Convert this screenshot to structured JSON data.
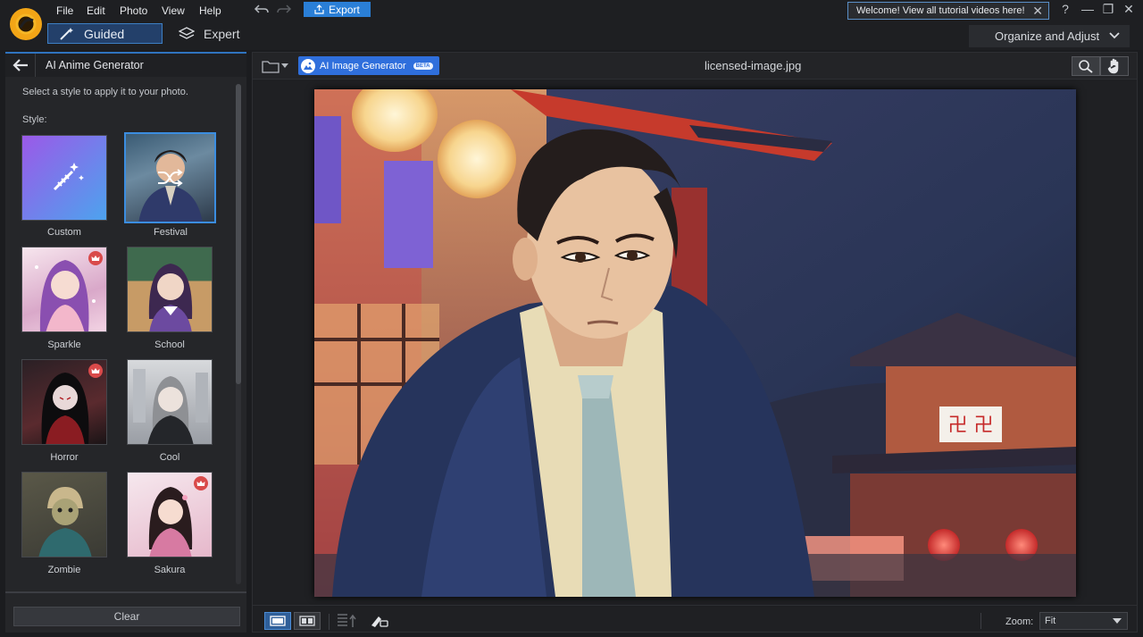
{
  "menu": [
    "File",
    "Edit",
    "Photo",
    "View",
    "Help"
  ],
  "toolbar": {
    "export_label": "Export"
  },
  "welcome": {
    "text": "Welcome! View all tutorial videos here!"
  },
  "modes": {
    "guided": "Guided",
    "expert": "Expert"
  },
  "workspace": {
    "selected": "Organize and Adjust"
  },
  "panel": {
    "title": "AI Anime Generator",
    "instruction": "Select a style to apply it to your photo.",
    "style_label": "Style:",
    "styles": [
      {
        "label": "Custom",
        "selected": false,
        "premium": false
      },
      {
        "label": "Festival",
        "selected": true,
        "premium": false
      },
      {
        "label": "Sparkle",
        "selected": false,
        "premium": true
      },
      {
        "label": "School",
        "selected": false,
        "premium": false
      },
      {
        "label": "Horror",
        "selected": false,
        "premium": true
      },
      {
        "label": "Cool",
        "selected": false,
        "premium": false
      },
      {
        "label": "Zombie",
        "selected": false,
        "premium": false
      },
      {
        "label": "Sakura",
        "selected": false,
        "premium": true
      }
    ],
    "clear_label": "Clear"
  },
  "canvas": {
    "ai_generator_label": "AI Image Generator",
    "beta_badge": "BETA",
    "file_name": "licensed-image.jpg"
  },
  "bottom": {
    "zoom_label": "Zoom:",
    "zoom_value": "Fit"
  },
  "colors": {
    "accent": "#2f73bf",
    "export": "#2a7fd7",
    "ai_button": "#2f6fdc",
    "premium_badge": "#d94a4a"
  }
}
